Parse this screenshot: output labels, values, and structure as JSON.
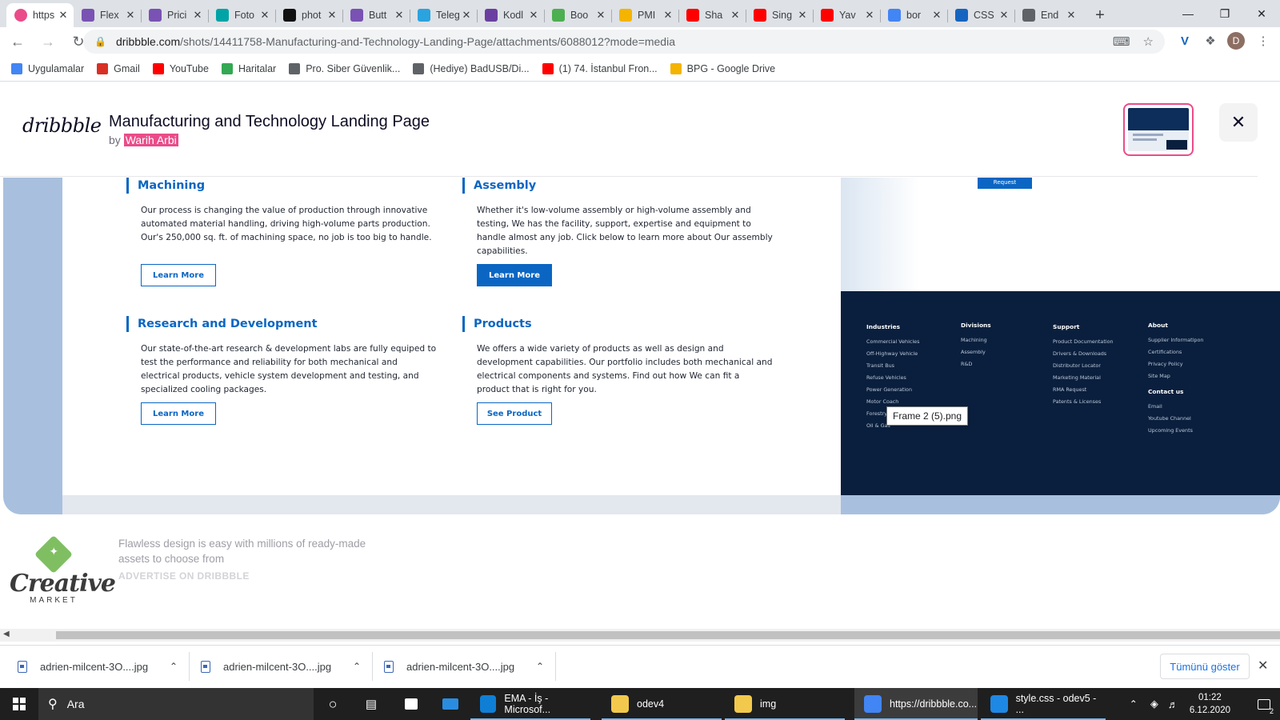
{
  "browser": {
    "tabs": [
      {
        "title": "https",
        "favicon": "dribbble",
        "color": "#ea4c89",
        "active": true
      },
      {
        "title": "Flex",
        "favicon": "bootstrap",
        "color": "#7952b3"
      },
      {
        "title": "Prici",
        "favicon": "bootstrap",
        "color": "#7952b3"
      },
      {
        "title": "Foto",
        "favicon": "photo-editor",
        "color": "#00a4a6"
      },
      {
        "title": "phot",
        "favicon": "unsplash",
        "color": "#111111"
      },
      {
        "title": "Butt",
        "favicon": "bootstrap",
        "color": "#7952b3"
      },
      {
        "title": "Teleg",
        "favicon": "telegram",
        "color": "#2aa3df"
      },
      {
        "title": "Kodl",
        "favicon": "form",
        "color": "#6b3fa0"
      },
      {
        "title": "Boo",
        "favicon": "w3schools",
        "color": "#4caf50"
      },
      {
        "title": "PMI",
        "favicon": "google-drive",
        "color": "#f4b400"
      },
      {
        "title": "Sha",
        "favicon": "youtube",
        "color": "#ff0000"
      },
      {
        "title": "Sing",
        "favicon": "youtube",
        "color": "#ff0000"
      },
      {
        "title": "Yav",
        "favicon": "youtube",
        "color": "#ff0000"
      },
      {
        "title": "bor",
        "favicon": "google",
        "color": "#4285f4"
      },
      {
        "title": "CSS",
        "favicon": "css-drop",
        "color": "#1565c0"
      },
      {
        "title": "End",
        "favicon": "globe",
        "color": "#5f6368"
      }
    ],
    "new_tab": "+",
    "url_host": "dribbble.com",
    "url_path": "/shots/14411758-Manufacturing-and-Technology-Landing-Page/attachments/6088012?mode=media",
    "profile_initial": "D"
  },
  "bookmarks": [
    {
      "label": "Uygulamalar",
      "icon": "apps-grid-icon",
      "color": "#4285f4"
    },
    {
      "label": "Gmail",
      "icon": "gmail-icon",
      "color": "#d93025"
    },
    {
      "label": "YouTube",
      "icon": "youtube-icon",
      "color": "#ff0000"
    },
    {
      "label": "Haritalar",
      "icon": "maps-icon",
      "color": "#34a853"
    },
    {
      "label": "Pro. Siber Güvenlik...",
      "icon": "cloud-icon",
      "color": "#5f6368"
    },
    {
      "label": "(Hediye) BadUSB/Di...",
      "icon": "cloud-icon",
      "color": "#5f6368"
    },
    {
      "label": "(1) 74. İstanbul Fron...",
      "icon": "youtube-icon",
      "color": "#ff0000"
    },
    {
      "label": "BPG - Google Drive",
      "icon": "google-drive-icon",
      "color": "#f4b400"
    }
  ],
  "shot": {
    "logo": "dribbble",
    "title": "Manufacturing and Technology Landing Page",
    "by": "by",
    "author": "Warih Arbi",
    "close": "✕"
  },
  "design": {
    "features": [
      {
        "title": "Machining",
        "body": "Our process is changing the value of production through innovative automated material handling, driving high-volume parts production. Our's 250,000 sq. ft. of machining space, no job is too big to handle.",
        "button": "Learn More",
        "filled": false
      },
      {
        "title": "Assembly",
        "body": "Whether it's low-volume assembly or high-volume assembly and testing, We has the facility, support, expertise and equipment to handle almost any job. Click below to learn more about Our assembly capabilities.",
        "button": "Learn More",
        "filled": true
      },
      {
        "title": "Research and Development",
        "body": "Our state-of-the-art research & development labs are fully equiped to test the performance and reliability for both mechanical and electrical products, vehicle system development and testing, and specialized cooling packages.",
        "button": "Learn More",
        "filled": false
      },
      {
        "title": "Products",
        "body": "We offers a wide variety of products as well as design and development capabilities. Our portfolio includes both mechanical and electrical components and systems. Find out how We can fit a product that is right for you.",
        "button": "See Product",
        "filled": false
      }
    ],
    "request_button": "Request",
    "footer": {
      "industries": {
        "title": "Industries",
        "items": [
          "Commercial Vehicles",
          "Off-Highway Vehicle",
          "Transit Bus",
          "Refuse Vehicles",
          "Power Generation",
          "Motor Coach",
          "Forestry",
          "Oil & Gas"
        ]
      },
      "divisions": {
        "title": "Divisions",
        "items": [
          "Machining",
          "Assembly",
          "R&D"
        ]
      },
      "support": {
        "title": "Support",
        "items": [
          "Product Documentation",
          "Drivers & Downloads",
          "Distributor Locator",
          "Marketing Material",
          "RMA Request",
          "Patents & Licenses"
        ]
      },
      "about": {
        "title": "About",
        "items": [
          "Supplier Informatipon",
          "Certifications",
          "Privacy Policy",
          "Site Map"
        ]
      },
      "contact": {
        "title": "Contact us",
        "items": [
          "Email",
          "Youtube Channel",
          "Upcoming Events"
        ]
      }
    },
    "tooltip": "Frame 2 (5).png"
  },
  "ad": {
    "brand_word": "Creative",
    "brand_sub": "MARKET",
    "text": "Flawless design is easy with millions of ready-made assets to choose from",
    "cta": "ADVERTISE ON DRIBBBLE"
  },
  "downloads": {
    "items": [
      "adrien-milcent-3O....jpg",
      "adrien-milcent-3O....jpg",
      "adrien-milcent-3O....jpg"
    ],
    "show_all": "Tümünü göster"
  },
  "taskbar": {
    "search_placeholder": "Ara",
    "apps": [
      {
        "label": "EMA - İş - Microsof...",
        "icon": "edge-icon",
        "color": "#0f7fd6"
      },
      {
        "label": "odev4",
        "icon": "folder-icon",
        "color": "#f2c94c"
      },
      {
        "label": "img",
        "icon": "folder-icon",
        "color": "#f2c94c"
      },
      {
        "label": "https://dribbble.co...",
        "icon": "chrome-icon",
        "color": "#4285f4",
        "active": true
      },
      {
        "label": "style.css - odev5 - ...",
        "icon": "vscode-icon",
        "color": "#1e88e5"
      }
    ],
    "time": "01:22",
    "date": "6.12.2020",
    "notifications": "2"
  }
}
